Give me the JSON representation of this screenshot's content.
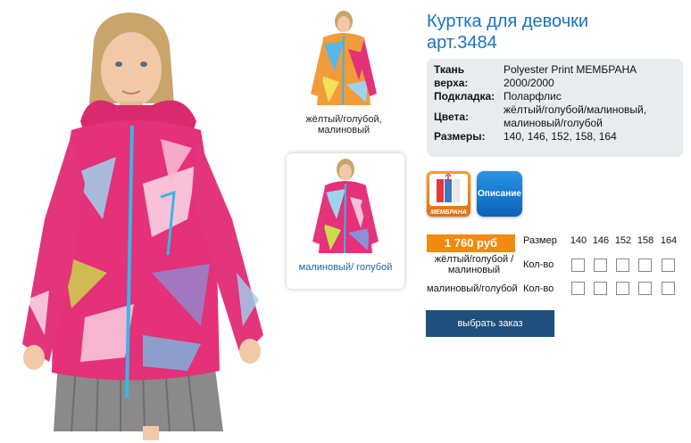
{
  "product": {
    "title_line1": "Куртка для девочки",
    "title_line2": "арт.3484"
  },
  "specs": [
    {
      "key": "Ткань",
      "value": "Polyester Print МЕМБРАНА"
    },
    {
      "key": "верха:",
      "value": "2000/2000"
    },
    {
      "key": "Подкладка:",
      "value": "Поларфлис"
    },
    {
      "key": "Цвета:",
      "value": "жёлтый/голубой/малиновый, малиновый/голубой"
    },
    {
      "key": "Размеры:",
      "value": "140, 146, 152, 158, 164"
    }
  ],
  "thumbnails": [
    {
      "caption": "жёлтый/голубой, малиновый"
    },
    {
      "caption": "малиновый/ голубой"
    }
  ],
  "badges": {
    "membrane": "МЕМБРАНА",
    "description": "Описание"
  },
  "order": {
    "price": "1 760 руб",
    "size_label": "Размер",
    "sizes": [
      "140",
      "146",
      "152",
      "158",
      "164"
    ],
    "rows": [
      {
        "color": "жёлтый/голубой /малиновый",
        "qty_label": "Кол-во"
      },
      {
        "color": "малиновый/голубой",
        "qty_label": "Кол-во"
      }
    ],
    "button": "выбрать заказ"
  },
  "colors": {
    "title": "#1a72c0",
    "price_bg": "#f08a10",
    "button_bg": "#1f4f7c",
    "info_bg": "#e9ecee",
    "jacket_pink": "#e5307a",
    "zipper_blue": "#3bb5e6"
  }
}
